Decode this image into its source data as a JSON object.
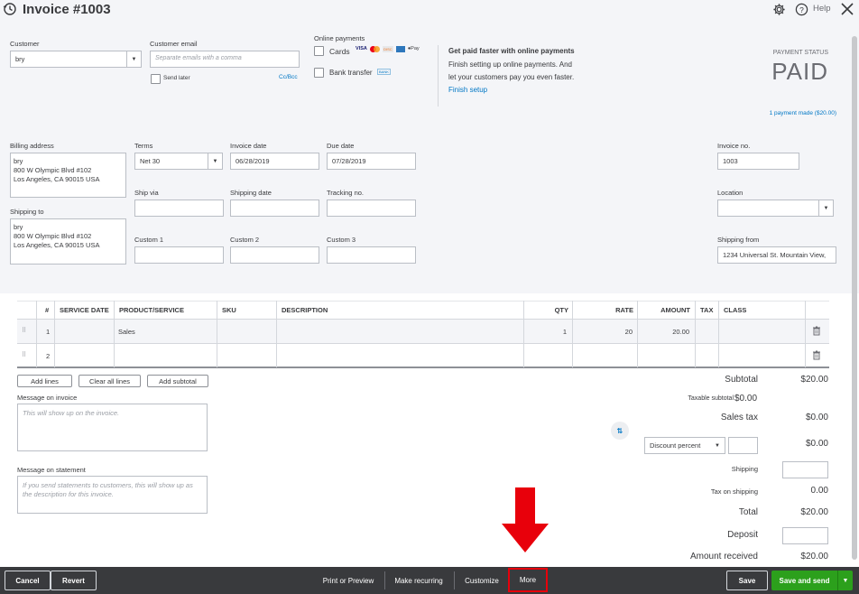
{
  "header": {
    "title": "Invoice #1003",
    "help_label": "Help"
  },
  "customer": {
    "label": "Customer",
    "value": "bry",
    "email_label": "Customer email",
    "email_placeholder": "Separate emails with a comma",
    "send_later_label": "Send later",
    "cc_bcc_label": "Cc/Bcc"
  },
  "online_payments": {
    "label": "Online payments",
    "cards_label": "Cards",
    "card_brands": [
      "VISA",
      "MC",
      "DISC",
      "AMEX",
      "Pay"
    ],
    "bank_label": "Bank transfer",
    "bank_badge": "BANK",
    "promo_title": "Get paid faster with online payments",
    "promo_line1": "Finish setting up online payments. And",
    "promo_line2": "let your customers pay you even faster.",
    "promo_link": "Finish setup"
  },
  "payment_status": {
    "label": "PAYMENT STATUS",
    "value": "PAID",
    "payment_link": "1 payment made ($20.00)"
  },
  "billing": {
    "label": "Billing address",
    "address": "bry\n800 W Olympic Blvd #102\nLos Angeles, CA  90015 USA"
  },
  "shipping_to": {
    "label": "Shipping to",
    "address": "bry\n800 W Olympic Blvd #102\nLos Angeles, CA  90015 USA"
  },
  "fields": {
    "terms_label": "Terms",
    "terms_value": "Net 30",
    "invoice_date_label": "Invoice date",
    "invoice_date_value": "06/28/2019",
    "due_date_label": "Due date",
    "due_date_value": "07/28/2019",
    "invoice_no_label": "Invoice no.",
    "invoice_no_value": "1003",
    "ship_via_label": "Ship via",
    "shipping_date_label": "Shipping date",
    "tracking_label": "Tracking no.",
    "location_label": "Location",
    "custom1_label": "Custom 1",
    "custom2_label": "Custom 2",
    "custom3_label": "Custom 3",
    "shipping_from_label": "Shipping from",
    "shipping_from_value": "1234 Universal St. Mountain View,"
  },
  "table": {
    "headers": [
      "#",
      "SERVICE DATE",
      "PRODUCT/SERVICE",
      "SKU",
      "DESCRIPTION",
      "QTY",
      "RATE",
      "AMOUNT",
      "TAX",
      "CLASS"
    ],
    "rows": [
      {
        "num": "1",
        "product": "Sales",
        "qty": "1",
        "rate": "20",
        "amount": "20.00"
      },
      {
        "num": "2",
        "product": "",
        "qty": "",
        "rate": "",
        "amount": ""
      }
    ],
    "add_lines": "Add lines",
    "clear_all_lines": "Clear all lines",
    "add_subtotal": "Add subtotal"
  },
  "messages": {
    "invoice_label": "Message on invoice",
    "invoice_placeholder": "This will show up on the invoice.",
    "statement_label": "Message on statement",
    "statement_placeholder": "If you send statements to customers, this will show up as the description for this invoice."
  },
  "totals": {
    "subtotal_label": "Subtotal",
    "subtotal_value": "$20.00",
    "taxable_label": "Taxable subtotal",
    "taxable_value": "$0.00",
    "sales_tax_label": "Sales tax",
    "sales_tax_value": "$0.00",
    "discount_select": "Discount percent",
    "discount_value": "$0.00",
    "shipping_label": "Shipping",
    "tax_on_shipping_label": "Tax on shipping",
    "tax_on_shipping_value": "0.00",
    "total_label": "Total",
    "total_value": "$20.00",
    "deposit_label": "Deposit",
    "amount_received_label": "Amount received",
    "amount_received_value": "$20.00"
  },
  "footer": {
    "cancel": "Cancel",
    "revert": "Revert",
    "print_preview": "Print or Preview",
    "make_recurring": "Make recurring",
    "customize": "Customize",
    "more": "More",
    "save": "Save",
    "save_and_send": "Save and send"
  },
  "colors": {
    "accent_green": "#2ca01c",
    "link_blue": "#0077c5",
    "highlight_red": "#e8000b",
    "footer_bg": "#393a3d"
  }
}
